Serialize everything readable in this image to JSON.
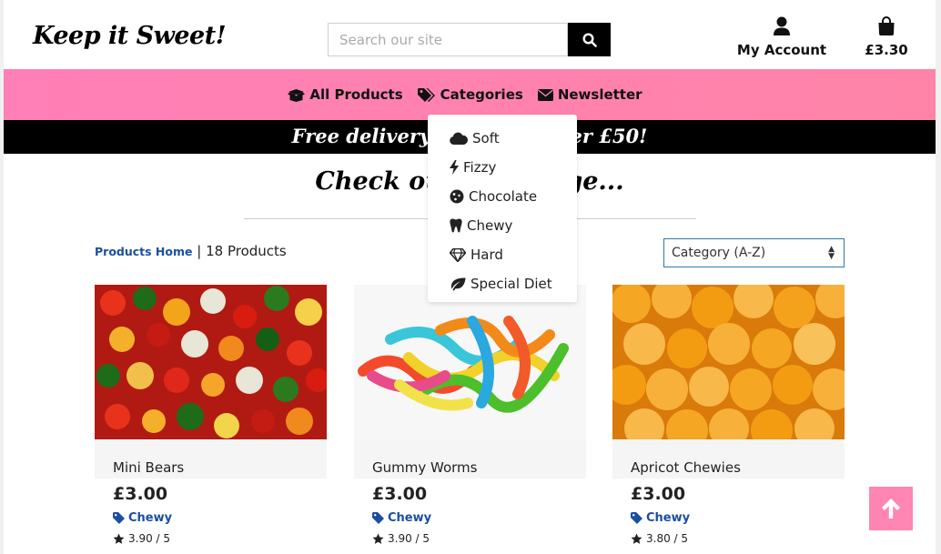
{
  "header": {
    "logo": "Keep it Sweet!",
    "search_placeholder": "Search our site",
    "account_label": "My Account",
    "bag_total": "£3.30"
  },
  "nav": {
    "items": [
      {
        "label": "All Products",
        "icon": "box-open-icon"
      },
      {
        "label": "Categories",
        "icon": "tags-icon"
      },
      {
        "label": "Newsletter",
        "icon": "envelope-icon"
      }
    ]
  },
  "banner": "Free delivery on orders over £50!",
  "headline": "Check out our range...",
  "breadcrumb": {
    "link": "Products Home",
    "separator": "|",
    "count": "18 Products"
  },
  "sort": {
    "selected": "Category (A-Z)"
  },
  "categories_menu": [
    {
      "label": "Soft",
      "icon": "cloud-icon"
    },
    {
      "label": "Fizzy",
      "icon": "bolt-icon"
    },
    {
      "label": "Chocolate",
      "icon": "cookie-icon"
    },
    {
      "label": "Chewy",
      "icon": "tooth-icon"
    },
    {
      "label": "Hard",
      "icon": "gem-icon"
    },
    {
      "label": "Special Diet",
      "icon": "leaf-icon"
    }
  ],
  "products": [
    {
      "name": "Mini Bears",
      "price": "£3.00",
      "category": "Chewy",
      "rating": "3.90 / 5"
    },
    {
      "name": "Gummy Worms",
      "price": "£3.00",
      "category": "Chewy",
      "rating": "3.90 / 5"
    },
    {
      "name": "Apricot Chewies",
      "price": "£3.00",
      "category": "Chewy",
      "rating": "3.80 / 5"
    }
  ],
  "colors": {
    "nav_pink": "#ff7fb6",
    "link_blue": "#1a4fa0",
    "back_to_top": "#ff85b3"
  }
}
